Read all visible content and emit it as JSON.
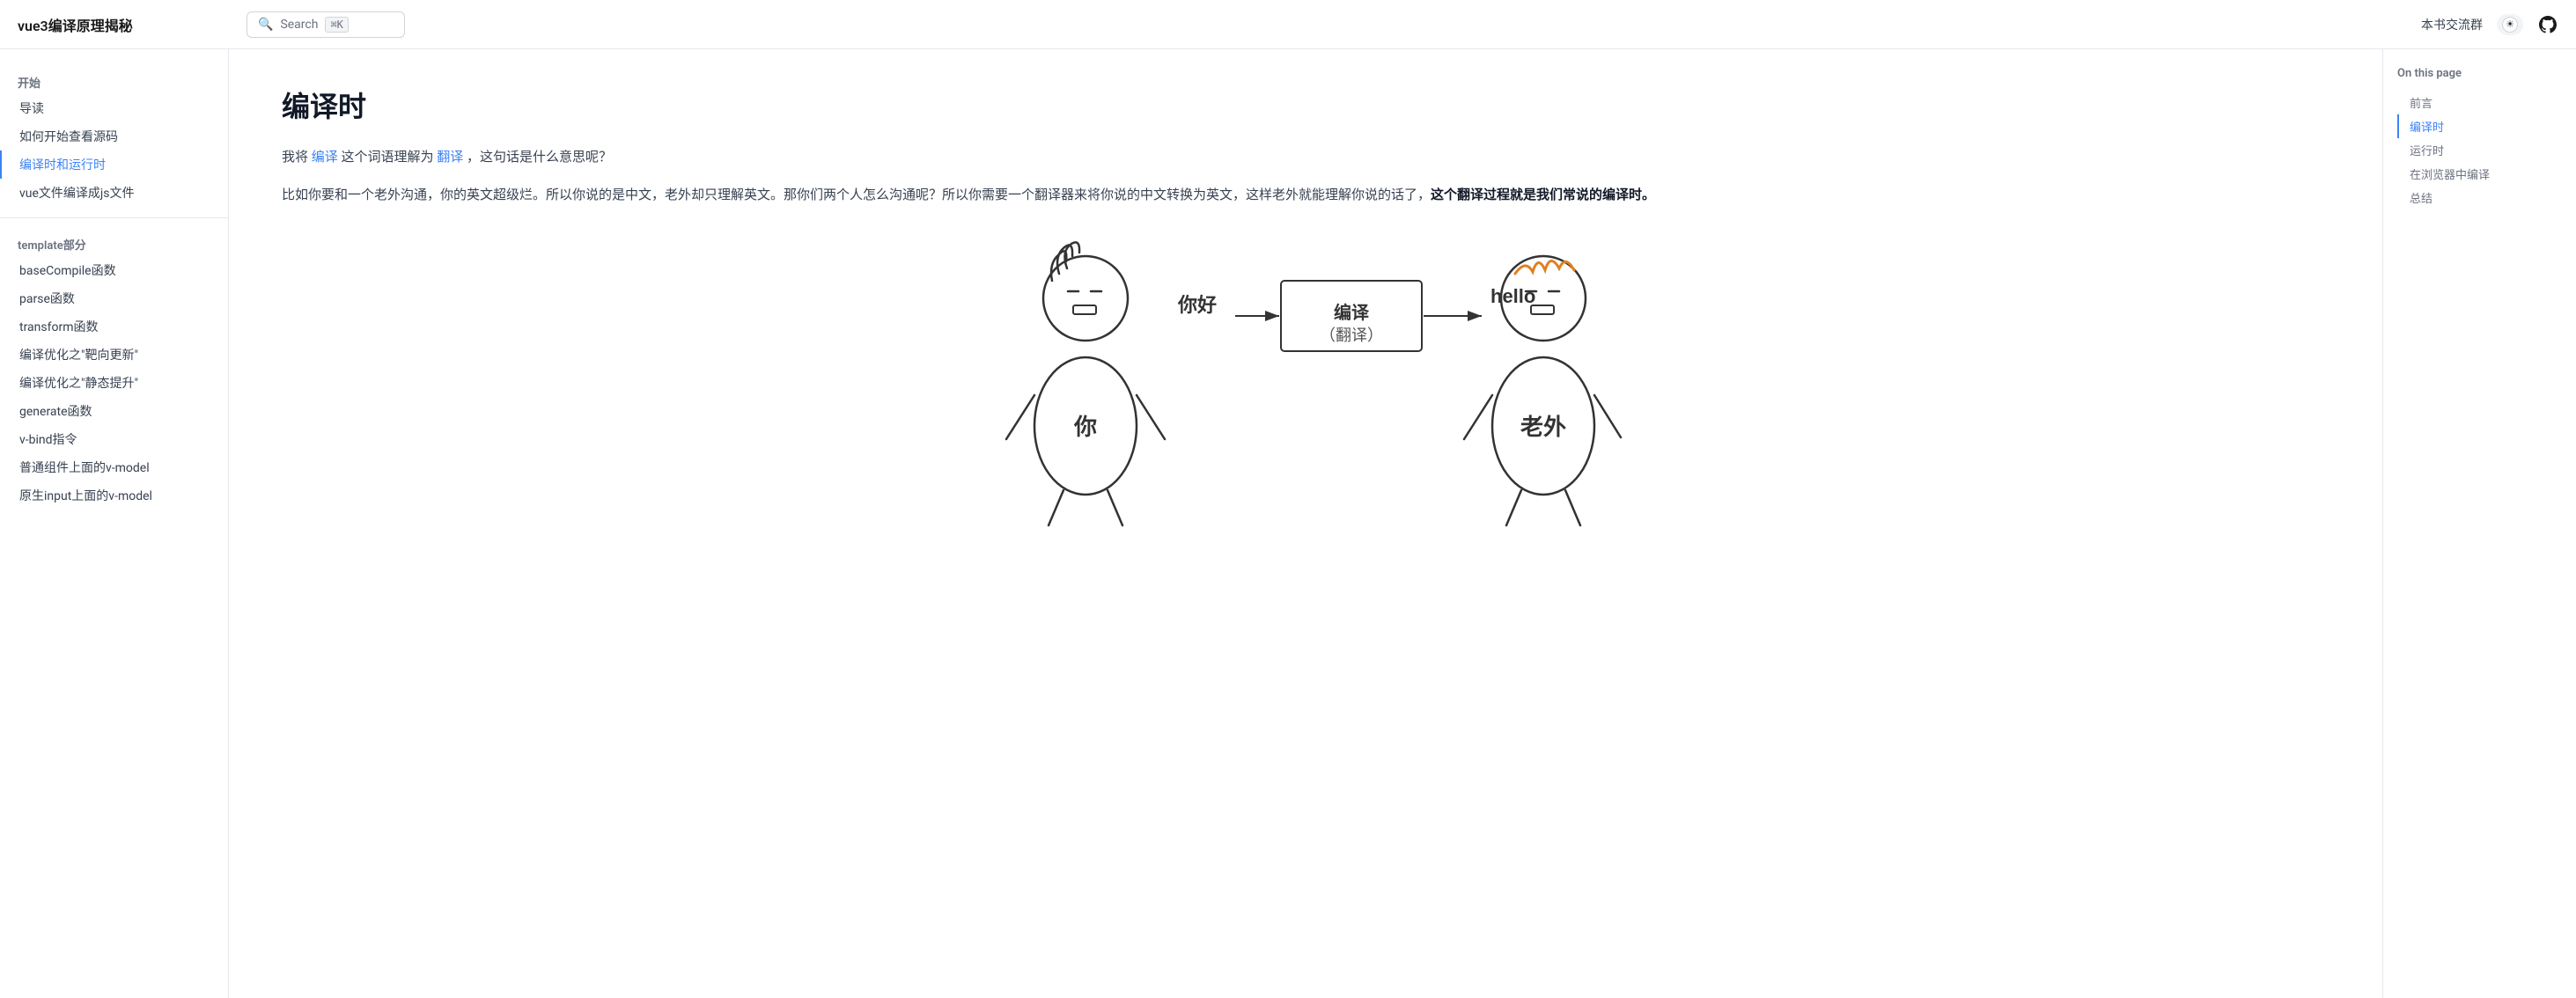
{
  "nav": {
    "logo": "vue3编译原理揭秘",
    "search_placeholder": "Search",
    "search_shortcut": "⌘K",
    "community_link": "本书交流群",
    "theme_icon": "☀",
    "github_label": "GitHub"
  },
  "sidebar": {
    "section1_title": "开始",
    "items_start": [
      {
        "label": "导读",
        "active": false
      },
      {
        "label": "如何开始查看源码",
        "active": false
      },
      {
        "label": "编译时和运行时",
        "active": true
      },
      {
        "label": "vue文件编译成js文件",
        "active": false
      }
    ],
    "section2_title": "template部分",
    "items_template": [
      {
        "label": "baseCompile函数",
        "active": false
      },
      {
        "label": "parse函数",
        "active": false
      },
      {
        "label": "transform函数",
        "active": false
      },
      {
        "label": "编译优化之\"靶向更新\"",
        "active": false
      },
      {
        "label": "编译优化之\"静态提升\"",
        "active": false
      },
      {
        "label": "generate函数",
        "active": false
      },
      {
        "label": "v-bind指令",
        "active": false
      },
      {
        "label": "普通组件上面的v-model",
        "active": false
      },
      {
        "label": "原生input上面的v-model",
        "active": false
      }
    ]
  },
  "page": {
    "title": "编译时",
    "intro": {
      "prefix": "我将",
      "link1": "编译",
      "middle": " 这个词语理解为",
      "link2": "翻译",
      "suffix": "，这句话是什么意思呢？"
    },
    "body": "比如你要和一个老外沟通，你的英文超级烂。所以你说的是中文，老外却只理解英文。那你们两个人怎么沟通呢？所以你需要一个翻译器来将你说的中文转换为英文，这样老外就能理解你说的话了，",
    "body_strong": "这个翻译过程就是我们常说的编译时。",
    "illustration_alt": "编译时示意图"
  },
  "toc": {
    "title": "On this page",
    "items": [
      {
        "label": "前言",
        "active": false
      },
      {
        "label": "编译时",
        "active": true
      },
      {
        "label": "运行时",
        "active": false
      },
      {
        "label": "在浏览器中编译",
        "active": false
      },
      {
        "label": "总结",
        "active": false
      }
    ]
  }
}
